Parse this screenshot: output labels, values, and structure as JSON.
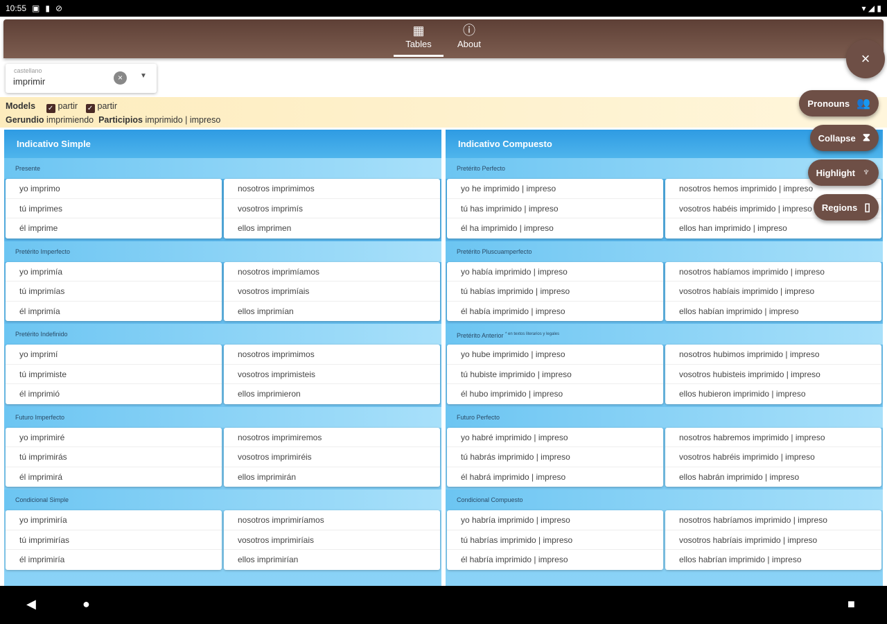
{
  "status": {
    "time": "10:55",
    "icons": [
      "notification-icon",
      "sd-card-icon",
      "sync-off-icon"
    ],
    "right_icons": "▾◢▮"
  },
  "tabs": [
    {
      "label": "Tables",
      "icon": "table-icon",
      "glyph": "▦",
      "active": true
    },
    {
      "label": "About",
      "icon": "help-icon",
      "glyph": "?",
      "active": false
    }
  ],
  "search": {
    "label": "castellano",
    "value": "imprimir"
  },
  "models": {
    "label": "Models",
    "items": [
      "partir",
      "partir"
    ],
    "gerundio_label": "Gerundio",
    "gerundio": "imprimiendo",
    "participios_label": "Participios",
    "participios": "imprimido | impreso"
  },
  "fabs": {
    "close": "×",
    "pronouns": "Pronouns",
    "collapse": "Collapse",
    "highlight": "Highlight",
    "regions": "Regions"
  },
  "columns": [
    {
      "title": "Indicativo Simple",
      "sections": [
        {
          "name": "Presente",
          "left": [
            "yo imprimo",
            "tú imprimes",
            "él imprime"
          ],
          "right": [
            "nosotros imprimimos",
            "vosotros imprimís",
            "ellos imprimen"
          ]
        },
        {
          "name": "Pretérito Imperfecto",
          "left": [
            "yo imprimía",
            "tú imprimías",
            "él imprimía"
          ],
          "right": [
            "nosotros imprimíamos",
            "vosotros imprimíais",
            "ellos imprimían"
          ]
        },
        {
          "name": "Pretérito Indefinido",
          "left": [
            "yo imprimí",
            "tú imprimiste",
            "él imprimió"
          ],
          "right": [
            "nosotros imprimimos",
            "vosotros imprimisteis",
            "ellos imprimieron"
          ]
        },
        {
          "name": "Futuro Imperfecto",
          "left": [
            "yo imprimiré",
            "tú imprimirás",
            "él imprimirá"
          ],
          "right": [
            "nosotros imprimiremos",
            "vosotros imprimiréis",
            "ellos imprimirán"
          ]
        },
        {
          "name": "Condicional Simple",
          "left": [
            "yo imprimiría",
            "tú imprimirías",
            "él imprimiría"
          ],
          "right": [
            "nosotros imprimiríamos",
            "vosotros imprimiríais",
            "ellos imprimirían"
          ]
        }
      ]
    },
    {
      "title": "Indicativo Compuesto",
      "sections": [
        {
          "name": "Pretérito Perfecto",
          "left": [
            "yo he imprimido | impreso",
            "tú has imprimido | impreso",
            "él ha imprimido | impreso"
          ],
          "right": [
            "nosotros hemos imprimido | impreso",
            "vosotros habéis imprimido | impreso",
            "ellos han imprimido | impreso"
          ]
        },
        {
          "name": "Pretérito Pluscuamperfecto",
          "left": [
            "yo había imprimido | impreso",
            "tú habías imprimido | impreso",
            "él había imprimido | impreso"
          ],
          "right": [
            "nosotros habíamos imprimido | impreso",
            "vosotros habíais imprimido | impreso",
            "ellos habían imprimido | impreso"
          ]
        },
        {
          "name": "Pretérito Anterior",
          "note": "* en textos literarios y legales",
          "left": [
            "yo hube imprimido | impreso",
            "tú hubiste imprimido | impreso",
            "él hubo imprimido | impreso"
          ],
          "right": [
            "nosotros hubimos imprimido | impreso",
            "vosotros hubisteis imprimido | impreso",
            "ellos hubieron imprimido | impreso"
          ]
        },
        {
          "name": "Futuro Perfecto",
          "left": [
            "yo habré imprimido | impreso",
            "tú habrás imprimido | impreso",
            "él habrá imprimido | impreso"
          ],
          "right": [
            "nosotros habremos imprimido | impreso",
            "vosotros habréis imprimido | impreso",
            "ellos habrán imprimido | impreso"
          ]
        },
        {
          "name": "Condicional Compuesto",
          "left": [
            "yo habría imprimido | impreso",
            "tú habrías imprimido | impreso",
            "él habría imprimido | impreso"
          ],
          "right": [
            "nosotros habríamos imprimido | impreso",
            "vosotros habríais imprimido | impreso",
            "ellos habrían imprimido | impreso"
          ]
        }
      ]
    }
  ],
  "colors": {
    "appbar": "#6e4f46",
    "header_blue": "#2e9be3",
    "models_bg": "#fdecbd"
  }
}
